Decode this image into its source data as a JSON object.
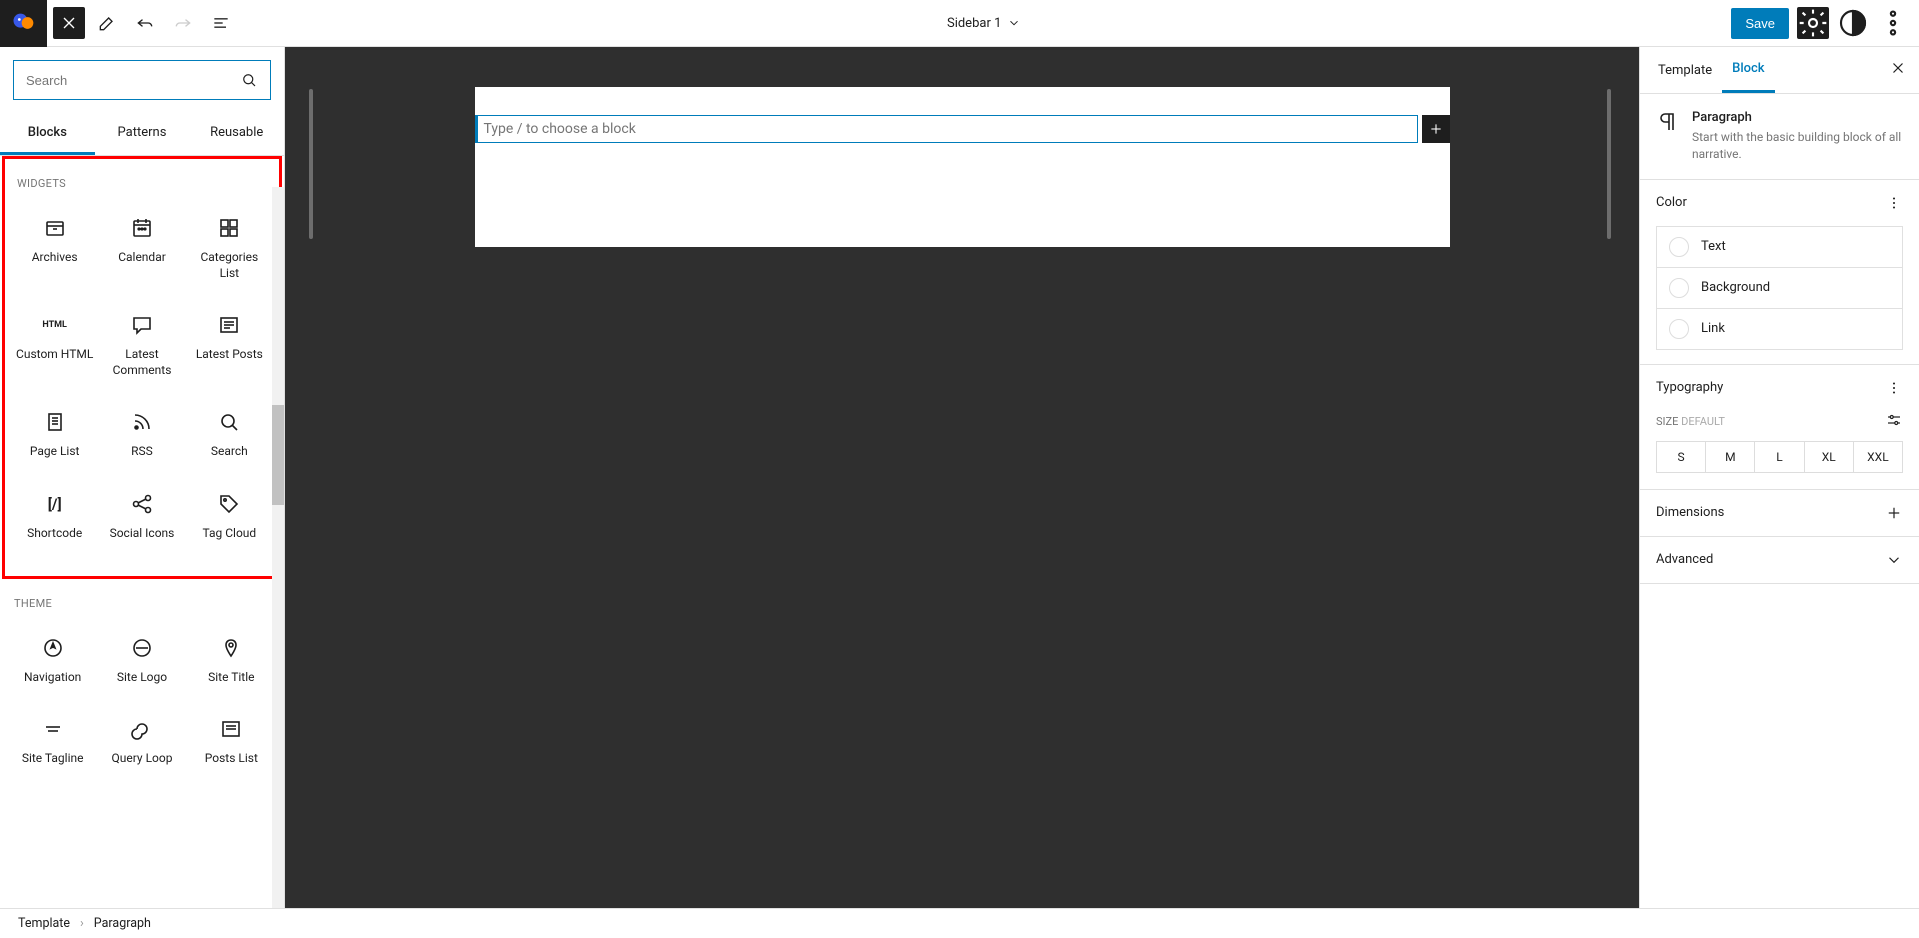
{
  "topbar": {
    "title": "Sidebar 1",
    "save_label": "Save"
  },
  "left": {
    "search_placeholder": "Search",
    "tabs": {
      "blocks": "Blocks",
      "patterns": "Patterns",
      "reusable": "Reusable"
    },
    "sections": {
      "widgets": {
        "title": "WIDGETS",
        "items": [
          {
            "label": "Archives",
            "icon": "archives-icon"
          },
          {
            "label": "Calendar",
            "icon": "calendar-icon"
          },
          {
            "label": "Categories List",
            "icon": "categories-icon"
          },
          {
            "label": "Custom HTML",
            "icon": "html-icon"
          },
          {
            "label": "Latest Comments",
            "icon": "comment-icon"
          },
          {
            "label": "Latest Posts",
            "icon": "latest-posts-icon"
          },
          {
            "label": "Page List",
            "icon": "page-list-icon"
          },
          {
            "label": "RSS",
            "icon": "rss-icon"
          },
          {
            "label": "Search",
            "icon": "search-icon"
          },
          {
            "label": "Shortcode",
            "icon": "shortcode-icon"
          },
          {
            "label": "Social Icons",
            "icon": "share-icon"
          },
          {
            "label": "Tag Cloud",
            "icon": "tag-icon"
          }
        ]
      },
      "theme": {
        "title": "THEME",
        "items": [
          {
            "label": "Navigation",
            "icon": "navigation-icon"
          },
          {
            "label": "Site Logo",
            "icon": "site-logo-icon"
          },
          {
            "label": "Site Title",
            "icon": "site-title-icon"
          },
          {
            "label": "Site Tagline",
            "icon": "site-tagline-icon"
          },
          {
            "label": "Query Loop",
            "icon": "query-loop-icon"
          },
          {
            "label": "Posts List",
            "icon": "posts-list-icon"
          }
        ]
      }
    }
  },
  "canvas": {
    "placeholder": "Type / to choose a block"
  },
  "right": {
    "tabs": {
      "template": "Template",
      "block": "Block"
    },
    "block_info": {
      "title": "Paragraph",
      "desc": "Start with the basic building block of all narrative."
    },
    "color": {
      "title": "Color",
      "rows": {
        "text": "Text",
        "background": "Background",
        "link": "Link"
      }
    },
    "typography": {
      "title": "Typography",
      "size_label": "SIZE",
      "size_default": "DEFAULT",
      "sizes": [
        "S",
        "M",
        "L",
        "XL",
        "XXL"
      ]
    },
    "dimensions": {
      "title": "Dimensions"
    },
    "advanced": {
      "title": "Advanced"
    }
  },
  "breadcrumb": {
    "root": "Template",
    "current": "Paragraph"
  }
}
